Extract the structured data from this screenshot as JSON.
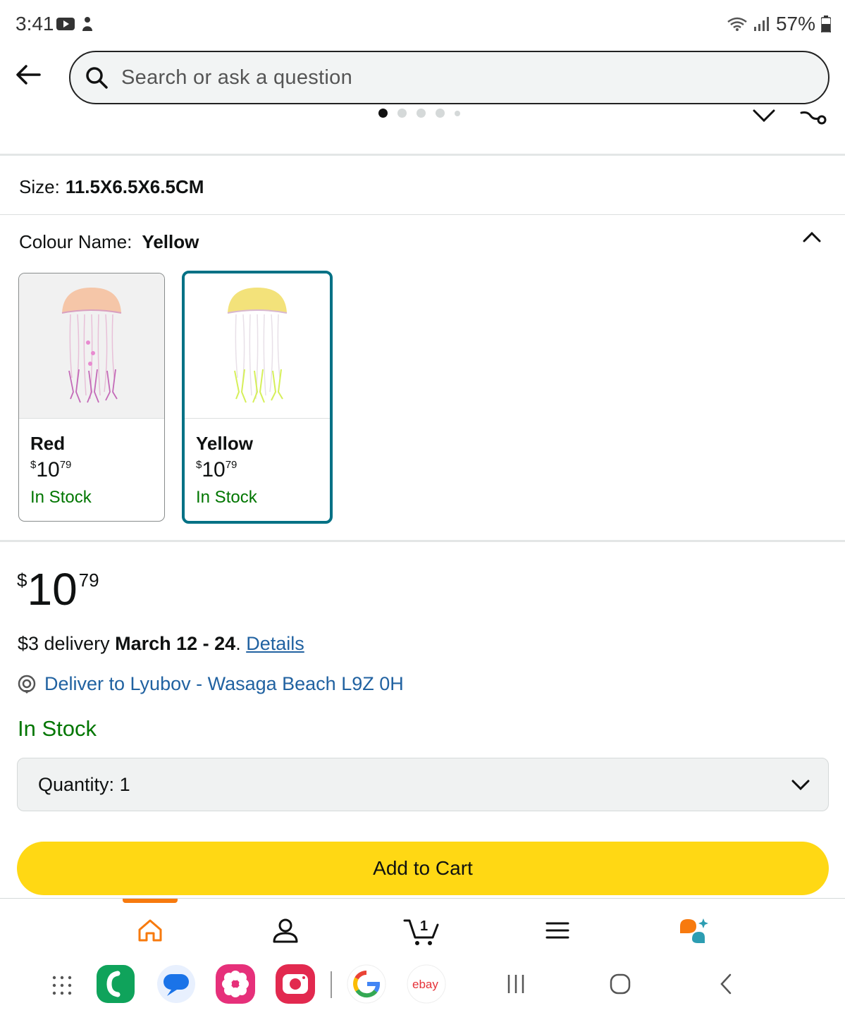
{
  "status": {
    "time": "3:41",
    "battery": "57%"
  },
  "search": {
    "placeholder": "Search or ask a question"
  },
  "product": {
    "size_label": "Size:",
    "size_value": "11.5X6.5X6.5CM",
    "colour_label": "Colour Name:",
    "colour_value": "Yellow",
    "options": [
      {
        "name": "Red",
        "currency": "$",
        "whole": "10",
        "fraction": "79",
        "stock": "In Stock"
      },
      {
        "name": "Yellow",
        "currency": "$",
        "whole": "10",
        "fraction": "79",
        "stock": "In Stock"
      }
    ],
    "price": {
      "currency": "$",
      "whole": "10",
      "fraction": "79"
    },
    "delivery_prefix": "$3 delivery",
    "delivery_date": "March 12 - 24",
    "delivery_sep": ".",
    "delivery_link": "Details",
    "deliver_to": "Deliver to Lyubov - Wasaga Beach L9Z 0H",
    "availability": "In Stock",
    "quantity_label": "Quantity:",
    "quantity_value": "1",
    "add_to_cart": "Add to Cart"
  },
  "cart": {
    "count": "1"
  },
  "dock": {
    "ebay_label": "ebay"
  },
  "colors": {
    "accent_teal": "#007185",
    "stock_green": "#007600",
    "link_blue": "#2162a1",
    "cart_yellow": "#ffd814",
    "nav_orange": "#f77a0e"
  },
  "icons": [
    "arrow-left-icon",
    "search-icon",
    "chevron-down-icon",
    "share-icon",
    "chevron-up-icon",
    "location-pin-icon",
    "home-icon",
    "account-icon",
    "cart-icon",
    "menu-icon",
    "rufus-icon"
  ]
}
